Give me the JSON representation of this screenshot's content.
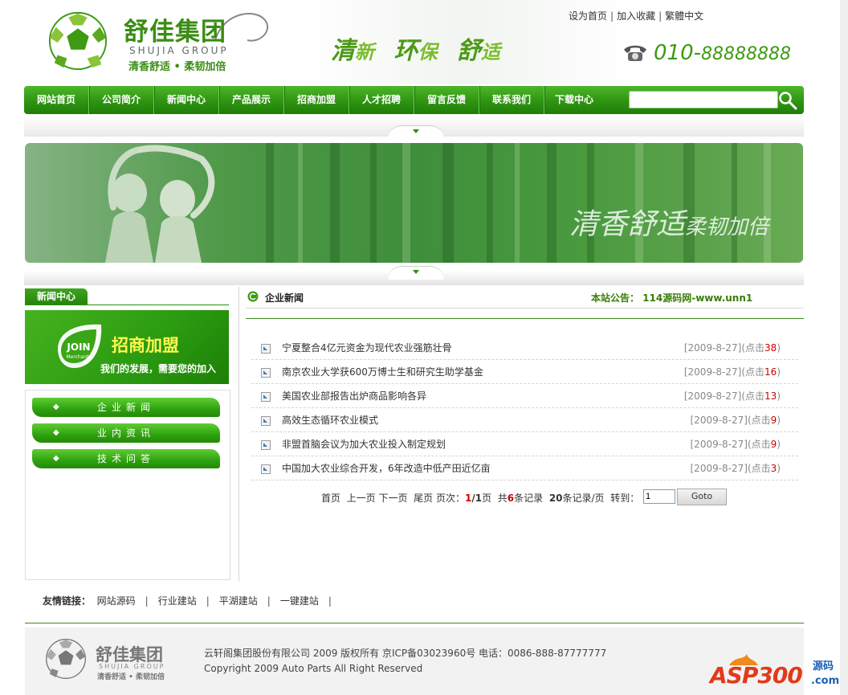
{
  "header": {
    "logo_cn": "舒佳集团",
    "logo_en": "SHUJIA GROUP",
    "logo_slogan": "清香舒适 • 柔韧加倍",
    "tagline": [
      "清",
      "新",
      "环",
      "保",
      "舒",
      "适"
    ],
    "toplinks": [
      "设为首页",
      "加入收藏",
      "繁體中文"
    ],
    "phone_prefix": "010-",
    "phone_rest": "88888888"
  },
  "nav": {
    "items": [
      "网站首页",
      "公司简介",
      "新闻中心",
      "产品展示",
      "招商加盟",
      "人才招聘",
      "留言反馈",
      "联系我们",
      "下载中心"
    ],
    "search_value": ""
  },
  "banner": {
    "text_big": "清香舒适",
    "text_small": "柔韧加倍"
  },
  "left": {
    "tab": "新闻中心",
    "join_title": "招商加盟",
    "join_sub": "我们的发展，需要您的加入",
    "join_badge": "JOIN",
    "join_badge_sub": "Merchants",
    "menu": [
      "企业新闻",
      "业内资讯",
      "技术问答"
    ]
  },
  "news": {
    "title": "企业新闻",
    "notice": "本站公告： 114源码网-www.unn1",
    "rows": [
      {
        "title": "宁夏整合4亿元资金为现代农业强筋壮骨",
        "date": "[2009-8-27]",
        "clicks_label": "点击",
        "clicks": "38"
      },
      {
        "title": "南京农业大学获600万博士生和研究生助学基金",
        "date": "[2009-8-27]",
        "clicks_label": "点击",
        "clicks": "16"
      },
      {
        "title": "美国农业部报告出炉商品影响各异",
        "date": "[2009-8-27]",
        "clicks_label": "点击",
        "clicks": "13"
      },
      {
        "title": "高效生态循环农业模式",
        "date": "[2009-8-27]",
        "clicks_label": "点击",
        "clicks": "9"
      },
      {
        "title": "非盟首脑会议为加大农业投入制定规划",
        "date": "[2009-8-27]",
        "clicks_label": "点击",
        "clicks": "9"
      },
      {
        "title": "中国加大农业综合开发，6年改造中低产田近亿亩",
        "date": "[2009-8-27]",
        "clicks_label": "点击",
        "clicks": "3"
      }
    ],
    "pager": {
      "first": "首页",
      "prev": "上一页",
      "next": "下一页",
      "last": "尾页",
      "page_label": "页次：",
      "current": "1",
      "total": "1",
      "page_unit": "页",
      "total_label": "共",
      "records": "6",
      "records_unit": "条记录",
      "per_page": "20",
      "per_page_unit": "条记录/页",
      "goto_label": "转到：",
      "goto_value": "1",
      "goto_button": "Goto"
    }
  },
  "friends": {
    "label": "友情链接：",
    "links": [
      "网站源码",
      "行业建站",
      "平湖建站",
      "一键建站"
    ]
  },
  "footer": {
    "line1": "云轩阁集团股份有限公司 2009 版权所有 京ICP备03023960号 电话：0086-888-87777777",
    "line2": "Copyright 2009 Auto Parts All Right Reserved",
    "logo_cn": "舒佳集团",
    "logo_en": "SHUJIA GROUP",
    "logo_slogan": "清香舒适 • 柔韧加倍"
  },
  "watermark": {
    "text": "ASP300",
    "cn": "源码",
    "com": ".com"
  },
  "colors": {
    "brand_green": "#3a8d14",
    "nav_green": "#2f9412",
    "accent_red": "#cc0000"
  }
}
